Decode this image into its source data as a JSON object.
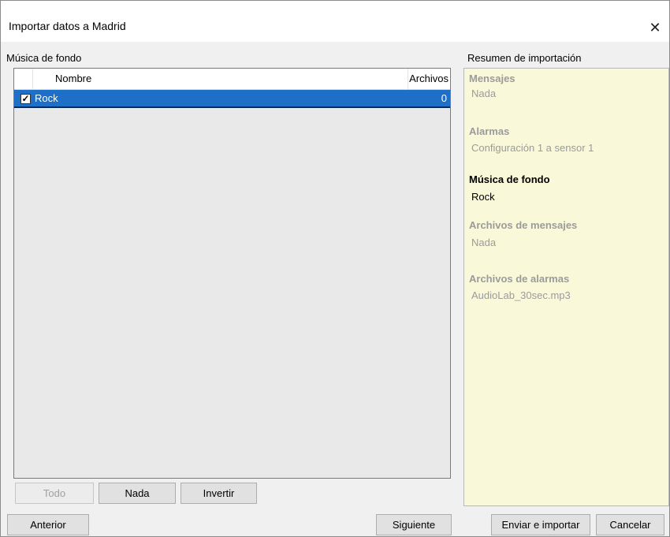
{
  "window": {
    "title": "Importar datos a Madrid",
    "close_glyph": "✕"
  },
  "left": {
    "section_label": "Música de fondo",
    "columns": {
      "name": "Nombre",
      "files": "Archivos"
    },
    "rows": [
      {
        "checked": true,
        "check_glyph": "✓",
        "name": "Rock",
        "files": "0"
      }
    ],
    "buttons": {
      "all": "Todo",
      "none": "Nada",
      "invert": "Invertir"
    }
  },
  "summary": {
    "section_label": "Resumen de importación",
    "items": [
      {
        "title": "Mensajes",
        "value": "Nada",
        "active": false
      },
      {
        "title": "Alarmas",
        "value": "Configuración 1 a sensor 1",
        "active": false
      },
      {
        "title": "Música de fondo",
        "value": "Rock",
        "active": true
      },
      {
        "title": "Archivos de mensajes",
        "value": "Nada",
        "active": false
      },
      {
        "title": "Archivos de alarmas",
        "value": "AudioLab_30sec.mp3",
        "active": false
      }
    ]
  },
  "footer": {
    "previous": "Anterior",
    "next": "Siguiente",
    "send_import": "Enviar e importar",
    "cancel": "Cancelar"
  },
  "colors": {
    "selection": "#1e6fc7",
    "summary_bg": "#f9f8d8",
    "disabled_text": "#9b9b9b"
  }
}
